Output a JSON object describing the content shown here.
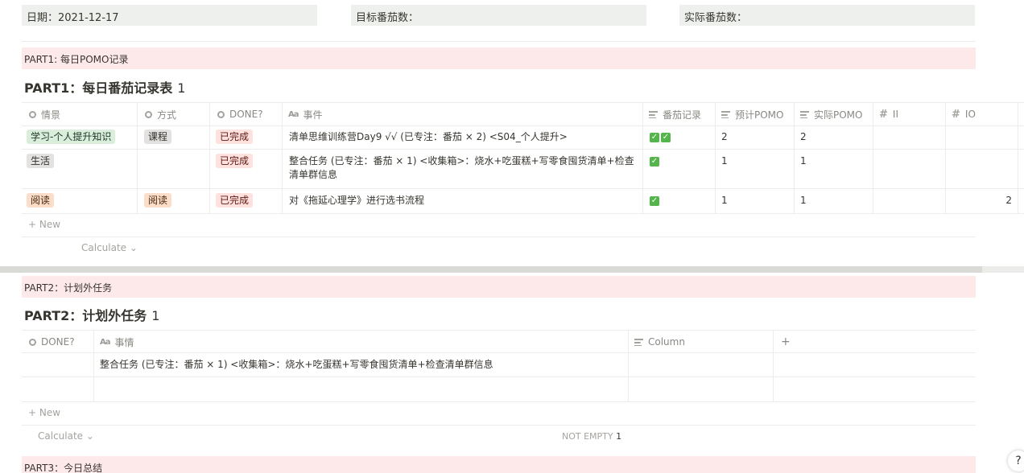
{
  "meta": {
    "date_label": "日期：2021-12-17",
    "target_label": "目标番茄数：",
    "actual_label": "实际番茄数："
  },
  "part1": {
    "callout": "PART1: 每日POMO记录",
    "title": "PART1：每日番茄记录表",
    "count": "1",
    "columns": [
      "情景",
      "方式",
      "DONE?",
      "事件",
      "番茄记录",
      "预计POMO",
      "实际POMO",
      "II",
      "IO"
    ],
    "rows": [
      {
        "scene": "学习-个人提升知识",
        "scene_color": "green",
        "method": "课程",
        "method_color": "gray",
        "done": "已完成",
        "event": "清单思维训练营Day9  √√ (已专注：番茄 × 2)  <S04_个人提升>",
        "pomo_checks": 2,
        "est": "2",
        "act": "2",
        "ii": "",
        "io": ""
      },
      {
        "scene": "生活",
        "scene_color": "gray",
        "method": "",
        "method_color": "",
        "done": "已完成",
        "event": "整合任务 (已专注：番茄 × 1)  <收集箱>：烧水+吃蛋糕+写零食囤货清单+检查清单群信息",
        "pomo_checks": 1,
        "est": "1",
        "act": "1",
        "ii": "",
        "io": ""
      },
      {
        "scene": "阅读",
        "scene_color": "orange",
        "method": "阅读",
        "method_color": "orange",
        "done": "已完成",
        "event": "对《拖延心理学》进行选书流程",
        "pomo_checks": 1,
        "est": "1",
        "act": "1",
        "ii": "",
        "io": "2"
      }
    ],
    "new_label": "New",
    "calculate_label": "Calculate"
  },
  "part2": {
    "callout": "PART2：计划外任务",
    "title": "PART2：计划外任务",
    "count": "1",
    "columns": [
      "DONE?",
      "事情",
      "Column"
    ],
    "rows": [
      {
        "done": "",
        "task": "整合任务 (已专注：番茄 × 1)  <收集箱>：烧水+吃蛋糕+写零食囤货清单+检查清单群信息",
        "column": ""
      }
    ],
    "new_label": "New",
    "calculate_label": "Calculate",
    "not_empty_label": "NOT EMPTY",
    "not_empty_value": "1"
  },
  "part3": {
    "callout": "PART3：今日总结"
  },
  "help_label": "?",
  "colors": {
    "callout_bg": "#fde9ea",
    "meta_bg": "#edf0ec",
    "done_tag": "#ffe2dd",
    "check_green": "#54b54a"
  }
}
